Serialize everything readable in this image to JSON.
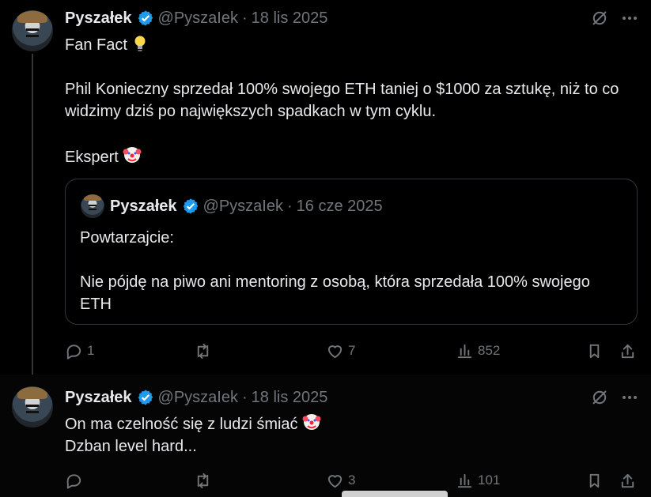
{
  "tweets": [
    {
      "author": "Pyszałek",
      "handle": "@PyszaIek",
      "separator": "·",
      "date": "18 lis 2025",
      "lines": [
        "Fan Fact",
        "Phil Konieczny sprzedał 100% swojego ETH taniej o $1000 za sztukę, niż to co widzimy dziś po największych spadkach w tym cyklu.",
        "Ekspert"
      ],
      "emojis": [
        "lightbulb",
        "clown-face"
      ],
      "quote": {
        "author": "Pyszałek",
        "handle": "@PyszaIek",
        "separator": "·",
        "date": "16 cze 2025",
        "lines": [
          "Powtarzajcie:",
          "Nie pójdę na piwo ani mentoring z osobą, która sprzedała 100% swojego ETH"
        ]
      },
      "actions": {
        "replies": "1",
        "reposts": "",
        "likes": "7",
        "views": "852"
      }
    },
    {
      "author": "Pyszałek",
      "handle": "@PyszaIek",
      "separator": "·",
      "date": "18 lis 2025",
      "lines": [
        "On ma czelność się z ludzi śmiać",
        "Dzban level hard..."
      ],
      "emojis": [
        "clown-face"
      ],
      "actions": {
        "replies": "",
        "reposts": "",
        "likes": "3",
        "views": "101"
      }
    }
  ],
  "colors": {
    "background": "#000000",
    "text": "#e7e9ea",
    "muted": "#71767b",
    "verified": "#1d9bf0"
  },
  "icons": [
    "verified-badge",
    "grok-icon",
    "more-icon",
    "reply-icon",
    "repost-icon",
    "like-icon",
    "views-icon",
    "bookmark-icon",
    "share-icon"
  ]
}
